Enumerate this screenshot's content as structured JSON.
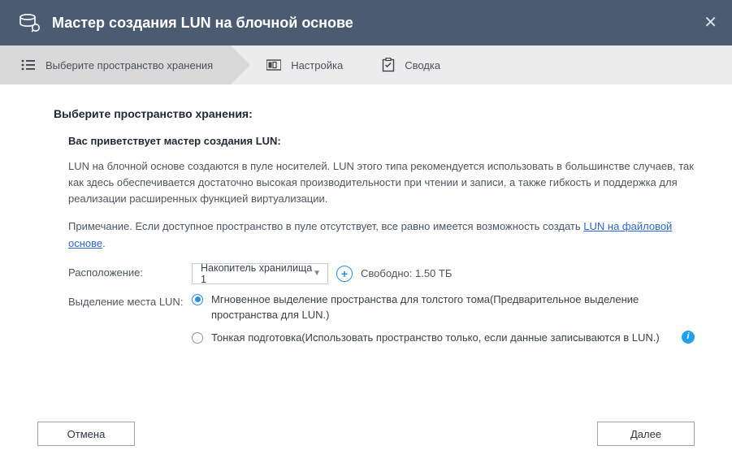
{
  "title": "Мастер создания LUN на блочной основе",
  "steps": {
    "storage": "Выберите пространство хранения",
    "configure": "Настройка",
    "summary": "Сводка"
  },
  "heading": "Выберите пространство хранения:",
  "subheading": "Вас приветствует мастер создания LUN:",
  "paragraph1": "LUN на блочной основе создаются в пуле носителей. LUN этого типа рекомендуется использовать в большинстве случаев, так как здесь обеспечивается достаточно высокая производительности при чтении и записи, а также гибкость и поддержка для реализации расширенных функцией виртуализации.",
  "note_prefix": "Примечание. Если доступное пространство в пуле отсутствует, все равно имеется возможность создать ",
  "note_link": "LUN на файловой основе",
  "note_suffix": ".",
  "form": {
    "location_label": "Расположение:",
    "location_value": "Накопитель хранилища 1",
    "free_space_label": "Свободно: 1.50 ТБ",
    "allocation_label": "Выделение места LUN:",
    "radio1": "Мгновенное выделение пространства для толстого тома(Предварительное выделение пространства для LUN.)",
    "radio2": "Тонкая подготовка(Использовать пространство только, если данные записываются в LUN.)"
  },
  "buttons": {
    "cancel": "Отмена",
    "next": "Далее"
  }
}
